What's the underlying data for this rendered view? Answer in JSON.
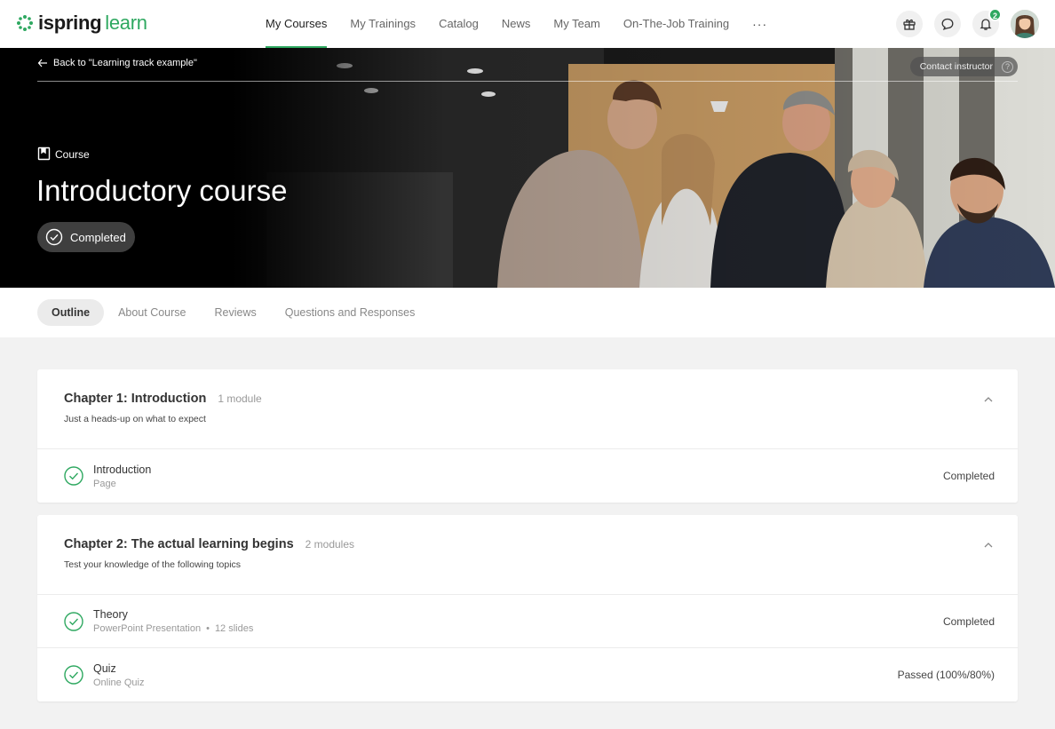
{
  "app": {
    "logo_primary": "ispring",
    "logo_secondary": "learn",
    "brand_color": "#2ea860"
  },
  "nav": {
    "items": [
      {
        "label": "My Courses",
        "active": true
      },
      {
        "label": "My Trainings",
        "active": false
      },
      {
        "label": "Catalog",
        "active": false
      },
      {
        "label": "News",
        "active": false
      },
      {
        "label": "My Team",
        "active": false
      },
      {
        "label": "On-The-Job Training",
        "active": false
      }
    ],
    "more_label": "···",
    "notification_count": "2",
    "icons": [
      "gift-icon",
      "chat-icon",
      "bell-icon",
      "avatar"
    ]
  },
  "hero": {
    "back_label": "Back to \"Learning track example\"",
    "contact_label": "Contact instructor",
    "help_glyph": "?",
    "type_label": "Course",
    "title": "Introductory course",
    "status_label": "Completed"
  },
  "tabs": [
    {
      "label": "Outline",
      "active": true
    },
    {
      "label": "About Course",
      "active": false
    },
    {
      "label": "Reviews",
      "active": false
    },
    {
      "label": "Questions and Responses",
      "active": false
    }
  ],
  "chapters": [
    {
      "title": "Chapter 1: Introduction",
      "count": "1 module",
      "description": "Just a heads-up on what to expect",
      "modules": [
        {
          "name": "Introduction",
          "type": "Page",
          "detail": "",
          "status": "Completed"
        }
      ]
    },
    {
      "title": "Chapter 2: The actual learning begins",
      "count": "2 modules",
      "description": "Test your knowledge of the following topics",
      "modules": [
        {
          "name": "Theory",
          "type": "PowerPoint Presentation",
          "separator": "•",
          "detail": "12 slides",
          "status": "Completed"
        },
        {
          "name": "Quiz",
          "type": "Online Quiz",
          "detail": "",
          "status": "Passed (100%/80%)"
        }
      ]
    }
  ]
}
